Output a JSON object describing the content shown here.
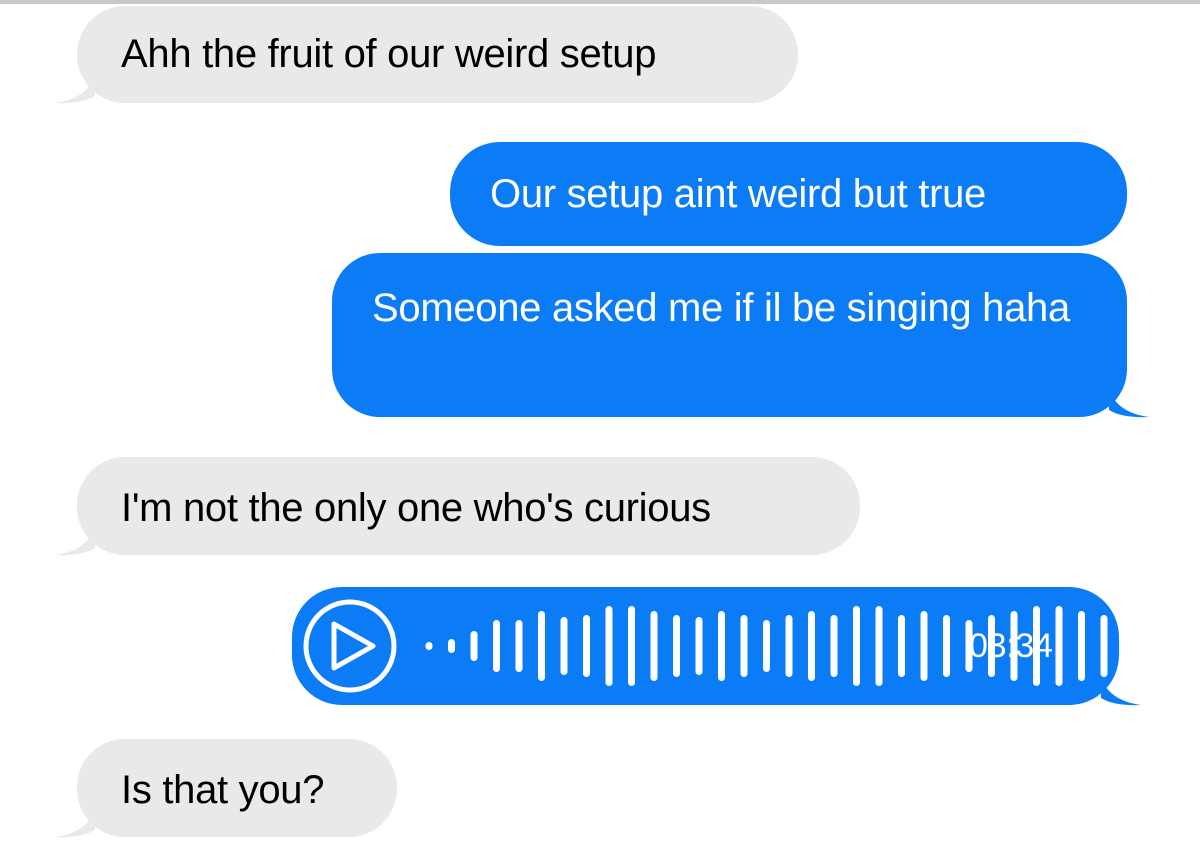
{
  "messages": [
    {
      "id": "m1",
      "direction": "incoming",
      "text": "Ahh the fruit of our weird setup"
    },
    {
      "id": "m2",
      "direction": "outgoing",
      "text": "Our setup aint weird but true"
    },
    {
      "id": "m3",
      "direction": "outgoing",
      "text": "Someone asked me if il be singing haha"
    },
    {
      "id": "m4",
      "direction": "incoming",
      "text": "I'm not the only one who's curious"
    },
    {
      "id": "m5",
      "direction": "outgoing",
      "type": "audio",
      "duration": "03:34",
      "icon": "play-icon",
      "waveform_icon": "waveform-icon"
    },
    {
      "id": "m6",
      "direction": "incoming",
      "text": "Is that you?"
    }
  ],
  "colors": {
    "incoming_bubble": "#e9e9eb",
    "outgoing_bubble": "#0b7cf6",
    "incoming_text": "#000000",
    "outgoing_text": "#ffffff"
  }
}
